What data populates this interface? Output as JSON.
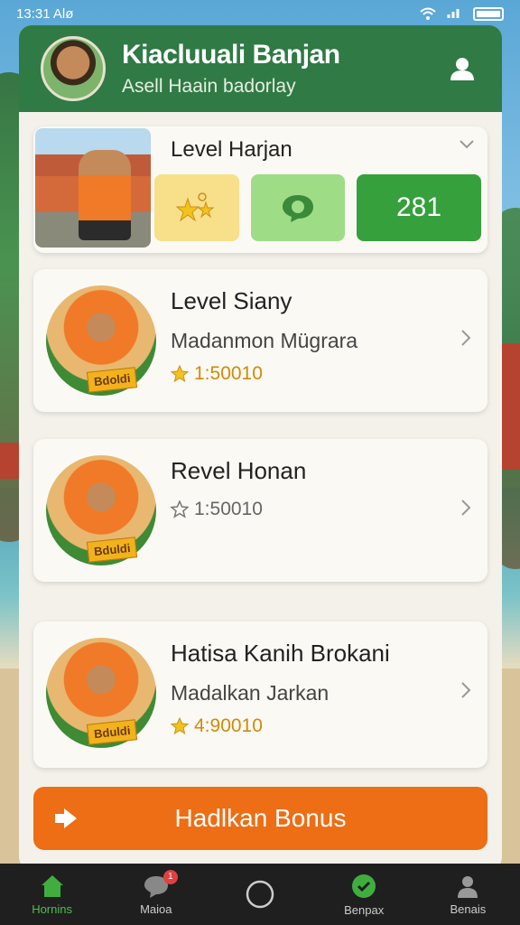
{
  "status_bar": {
    "time": "13:31 Alø"
  },
  "header": {
    "title": "Kiacluuali Banjan",
    "subtitle": "Asell Haain badorlay"
  },
  "top_card": {
    "label": "Level Harjan",
    "score": "281"
  },
  "levels": [
    {
      "name": "Level Siany",
      "desc": "Madanmon Mügrara",
      "rating": "1:50010",
      "star": "filled",
      "tag": "Bdoldi"
    },
    {
      "name": "Revel Honan",
      "desc": "",
      "rating": "1:50010",
      "star": "outline",
      "tag": "Bduldi"
    },
    {
      "name": "Hatisa Kanih Brokani",
      "desc": "Madalkan Jarkan",
      "rating": "4:90010",
      "star": "filled",
      "tag": "Bduldi"
    }
  ],
  "bonus_button": {
    "label": "Hadlkan Bonus"
  },
  "bottom_nav": [
    {
      "label": "Hornins",
      "icon": "home-icon",
      "active": true
    },
    {
      "label": "Maioa",
      "icon": "chat-icon",
      "badge": "1"
    },
    {
      "label": "",
      "icon": "circle-icon"
    },
    {
      "label": "Benpax",
      "icon": "check-icon"
    },
    {
      "label": "Benais",
      "icon": "profile-icon"
    }
  ],
  "colors": {
    "header": "#2f7a45",
    "accent_orange": "#ed6e15",
    "green_score": "#35a03c",
    "star_gold": "#d08a08"
  }
}
